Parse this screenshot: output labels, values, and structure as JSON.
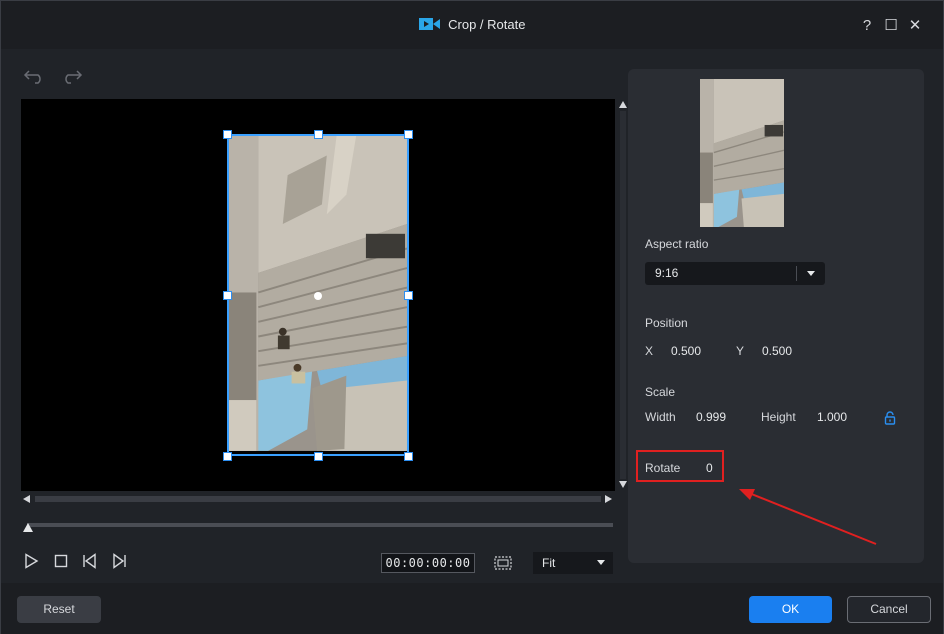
{
  "window": {
    "title": "Crop / Rotate",
    "help_symbol": "?",
    "maximize_symbol": "☐",
    "close_symbol": "✕"
  },
  "player": {
    "timecode": "00:00:00:00",
    "zoom_value": "Fit",
    "playhead_fraction": 0.0
  },
  "panel": {
    "aspect_ratio_label": "Aspect ratio",
    "aspect_ratio_value": "9:16",
    "position_label": "Position",
    "x_label": "X",
    "x_value": "0.500",
    "y_label": "Y",
    "y_value": "0.500",
    "scale_label": "Scale",
    "width_label": "Width",
    "width_value": "0.999",
    "height_label": "Height",
    "height_value": "1.000",
    "rotate_label": "Rotate",
    "rotate_value": "0"
  },
  "footer": {
    "reset_label": "Reset",
    "ok_label": "OK",
    "cancel_label": "Cancel"
  },
  "colors": {
    "accent": "#1a7ff0",
    "crop_frame": "#3aa0ff",
    "annotation": "#e02020"
  },
  "icons": [
    "app-icon",
    "undo-icon",
    "redo-icon",
    "play-icon",
    "stop-icon",
    "previous-frame-icon",
    "next-frame-icon",
    "fit-screen-icon",
    "lock-icon"
  ]
}
